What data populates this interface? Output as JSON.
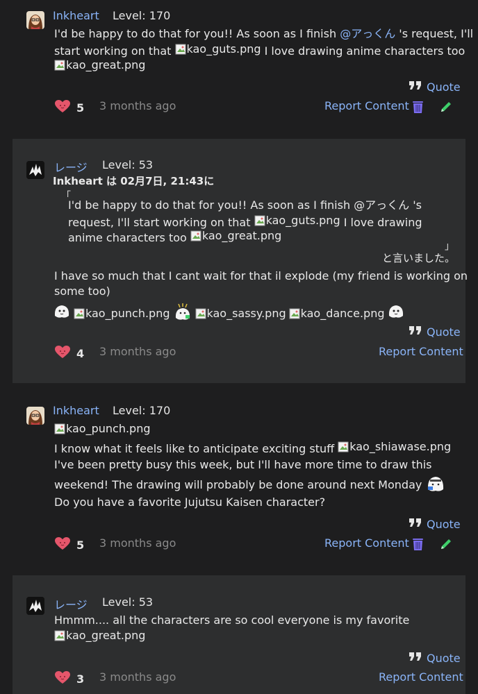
{
  "posts": [
    {
      "username": "Inkheart",
      "level": "Level: 170",
      "lines": {
        "l1_a": "I'd be happy to do that for you!! As soon as I finish ",
        "l1_mention": "@アっくん",
        "l1_b": " 's request, I'll",
        "l2_a": "start working on that ",
        "l2_img": "kao_guts.png",
        "l2_b": " I love drawing anime characters too",
        "l3_img": "kao_great.png"
      },
      "quote": "Quote",
      "likes": "5",
      "ago": "3 months ago",
      "report": "Report Content"
    },
    {
      "username": "レージ",
      "level": "Level: 53",
      "quote_meta": "Inkheart は 02月7日, 21:43に",
      "quoted": {
        "l1": "I'd be happy to do that for you!! As soon as I finish @アっくん 's",
        "l2_a": "request, I'll start working on that ",
        "l2_img": "kao_guts.png",
        "l2_b": " I love drawing",
        "l3_a": "anime characters too ",
        "l3_img": "kao_great.png",
        "said": "と言いました。"
      },
      "lines": {
        "l1": "I have so much that I cant wait for that il explode (my friend is working on",
        "l2": "some too)",
        "img_punch": "kao_punch.png",
        "img_sassy": "kao_sassy.png",
        "img_dance": "kao_dance.png"
      },
      "quote": "Quote",
      "likes": "4",
      "ago": "3 months ago",
      "report": "Report Content"
    },
    {
      "username": "Inkheart",
      "level": "Level: 170",
      "lines": {
        "img_punch": "kao_punch.png",
        "l2_a": "I know what it feels like to anticipate exciting stuff ",
        "l2_img": "kao_shiawase.png",
        "l3": "I've been pretty busy this week, but I'll have more time to draw this",
        "l4": "weekend! The drawing will probably be done around next Monday",
        "l5": "Do you have a favorite Jujutsu Kaisen character?"
      },
      "quote": "Quote",
      "likes": "5",
      "ago": "3 months ago",
      "report": "Report Content"
    },
    {
      "username": "レージ",
      "level": "Level: 53",
      "lines": {
        "l1": "Hmmm.... all the characters are so cool everyone is my favorite",
        "l2_img": "kao_great.png"
      },
      "quote": "Quote",
      "likes": "3",
      "ago": "3 months ago",
      "report": "Report Content"
    }
  ],
  "colors": {
    "background": "#1e1e1f",
    "alt_background": "#2d2e2f",
    "link": "#8ab4f8",
    "heart": "#e5566b",
    "trash": "#7b6cf0",
    "pencil": "#3ecf6a",
    "muted": "#8a8a8a"
  },
  "icons": [
    "avatar-inkheart",
    "avatar-reiji",
    "quote-icon",
    "heart-icon",
    "trash-icon",
    "pencil-icon",
    "broken-image-icon",
    "kaomoji-ghost-icon"
  ]
}
